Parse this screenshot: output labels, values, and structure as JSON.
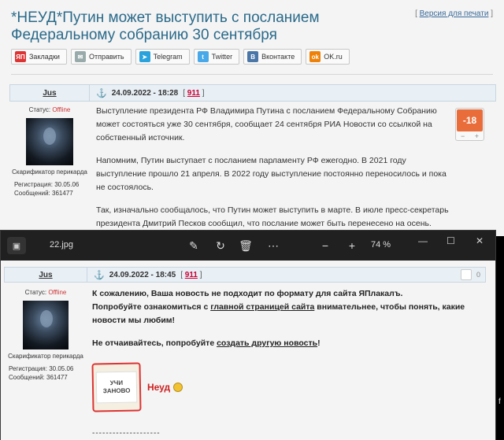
{
  "forum": {
    "title": "*НЕУД*Путин может выступить с посланием Федеральному собранию 30 сентября",
    "print_open": "[ ",
    "print_link": "Версия для печати",
    "print_close": " ]",
    "share": [
      {
        "label": "Закладки",
        "icon": "yaplakal-icon",
        "glyph": "ЯП",
        "color": "#d33"
      },
      {
        "label": "Отправить",
        "icon": "mail-icon",
        "glyph": "✉",
        "color": "#9aa"
      },
      {
        "label": "Telegram",
        "icon": "telegram-icon",
        "glyph": "➤",
        "color": "#2aa3dd"
      },
      {
        "label": "Twitter",
        "icon": "twitter-icon",
        "glyph": "t",
        "color": "#49a9e8"
      },
      {
        "label": "Вконтакте",
        "icon": "vk-icon",
        "glyph": "B",
        "color": "#4a76a8"
      },
      {
        "label": "OK.ru",
        "icon": "ok-icon",
        "glyph": "ok",
        "color": "#ee8208"
      }
    ],
    "post": {
      "author": "Jus",
      "date": "24.09.2022 - 18:28",
      "number_open": "[ ",
      "number": "911",
      "number_close": " ]",
      "status_label": "Статус:",
      "status": "Offline",
      "user_title": "Скарификатор перикарда",
      "reg_label": "Регистрация:",
      "reg": "30.05.06",
      "posts_label": "Сообщений:",
      "posts": "361477",
      "rating": "-18",
      "paragraphs": [
        "Выступление президента РФ Владимира Путина с посланием Федеральному Собранию может состояться уже 30 сентября, сообщает 24 сентября РИА Новости со ссылкой на собственный источник.",
        "Напомним, Путин выступает с посланием парламенту РФ ежегодно. В 2021 году выступление прошло 21 апреля. В 2022 году выступление постоянно переносилось и пока не состоялось.",
        "Так, изначально сообщалось, что Путин может выступить в марте. В июле пресс-секретарь президента Дмитрий Песков сообщил, что послание может быть перенесено на осень."
      ]
    }
  },
  "viewer": {
    "filename": "22.jpg",
    "zoom": "74 %",
    "post": {
      "author": "Jus",
      "date": "24.09.2022 - 18:45",
      "number_open": "[ ",
      "number": "911",
      "number_close": " ]",
      "rating": "0",
      "status_label": "Статус:",
      "status": "Offline",
      "user_title": "Скарификатор перикарда",
      "reg_label": "Регистрация:",
      "reg": "30.05.06",
      "posts_label": "Сообщений:",
      "posts": "361477",
      "line1": "К сожалению, Ваша новость не подходит по формату для сайта ЯПлакалъ.",
      "line2_pre": "Попробуйте ознакомиться с ",
      "line2_link": "главной страницей сайта",
      "line2_post": " внимательнее, чтобы понять, какие новости мы любим!",
      "line3_pre": "Не отчаивайтесь, попробуйте ",
      "line3_link": "создать другую новость",
      "line3_post": "!",
      "stamp_line1": "УЧИ",
      "stamp_line2": "ЗАНОВО",
      "grade": "Неуд",
      "signature_dashes": "--------------------"
    }
  },
  "edge_char": "f"
}
